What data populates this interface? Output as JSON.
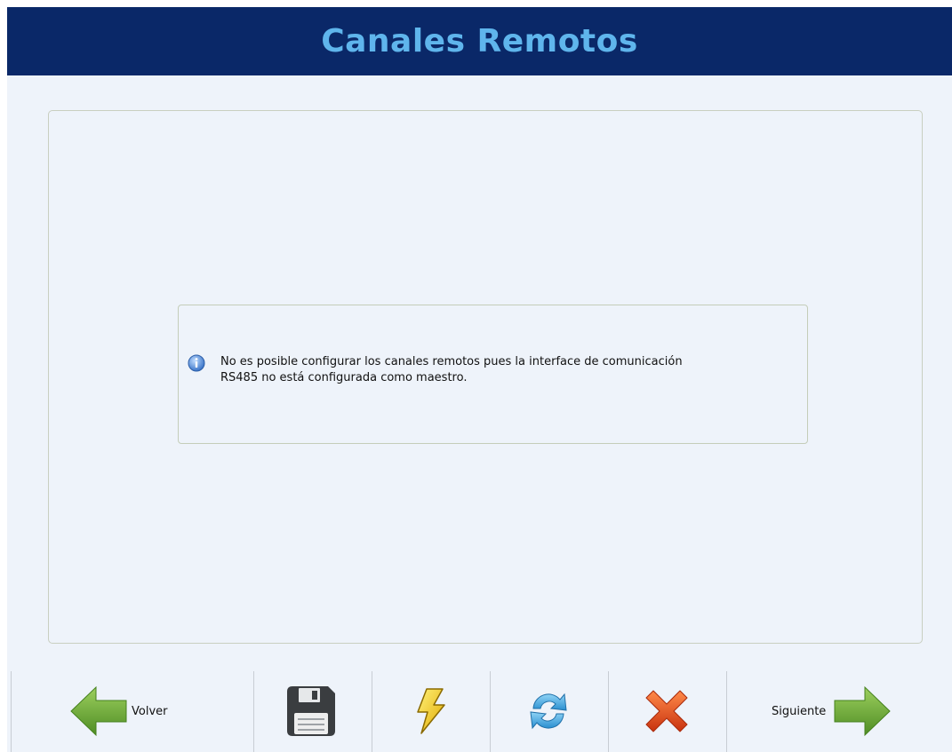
{
  "header": {
    "title": "Canales Remotos"
  },
  "message": {
    "line1": "No es posible configurar los canales remotos pues la interface de comunicación",
    "line2": "RS485 no está configurada como maestro.",
    "icon": "info-icon"
  },
  "toolbar": {
    "back_label": "Volver",
    "next_label": "Siguiente",
    "buttons": [
      "back-arrow-icon",
      "save-icon",
      "flash-icon",
      "refresh-icon",
      "cancel-icon",
      "next-arrow-icon"
    ]
  },
  "colors": {
    "header_bg": "#0a2868",
    "title_text": "#5fb5ec",
    "window_bg": "#eef3fa",
    "arrow_green": "#6aa83a",
    "cancel_red": "#e04a1c"
  }
}
